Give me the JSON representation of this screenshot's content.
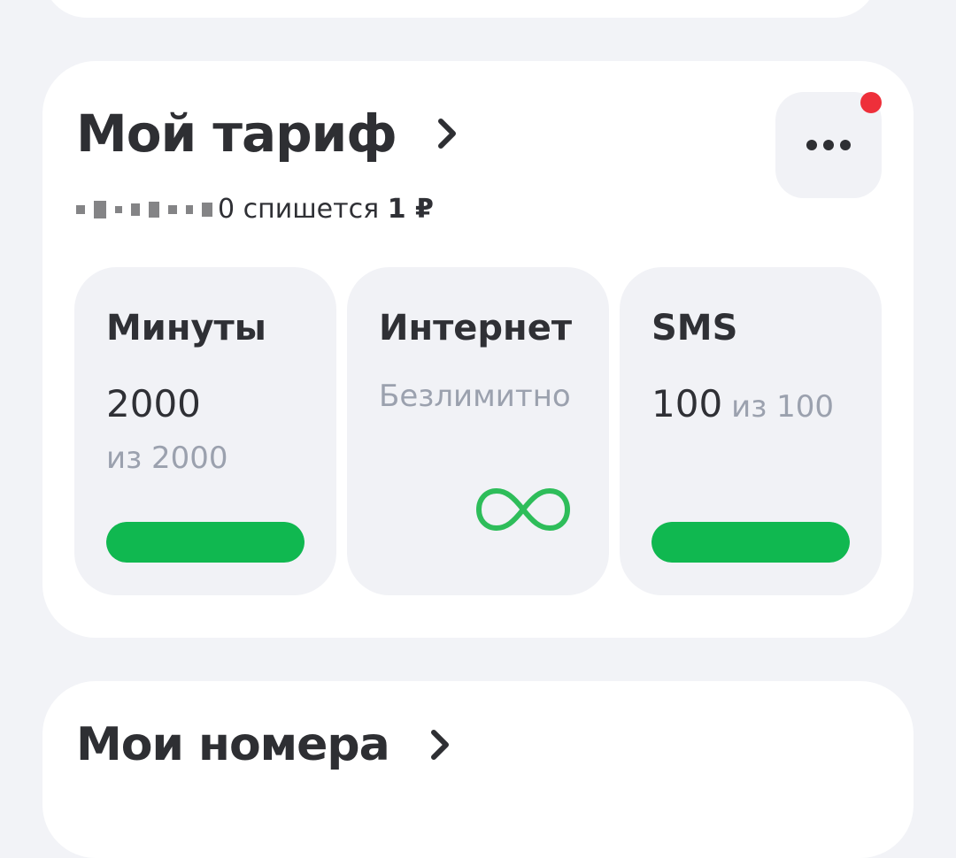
{
  "tariff": {
    "title": "Мой тариф",
    "subtitle_suffix": "0 спишется",
    "subtitle_amount": "1 ₽",
    "more_icon": "more-dots-icon",
    "notification_color": "#ee2f3a"
  },
  "tiles": [
    {
      "title": "Минуты",
      "value": "2000",
      "of": "из 2000",
      "progress": 1.0
    },
    {
      "title": "Интернет",
      "value": "Безлимитно",
      "icon": "infinity-icon"
    },
    {
      "title": "SMS",
      "value": "100",
      "of": "из 100",
      "progress": 1.0
    }
  ],
  "numbers": {
    "title": "Мои номера"
  },
  "colors": {
    "accent": "#10b850",
    "background": "#f2f3f7",
    "card": "#ffffff",
    "tile": "#f1f2f6",
    "muted": "#9ba1ae"
  }
}
